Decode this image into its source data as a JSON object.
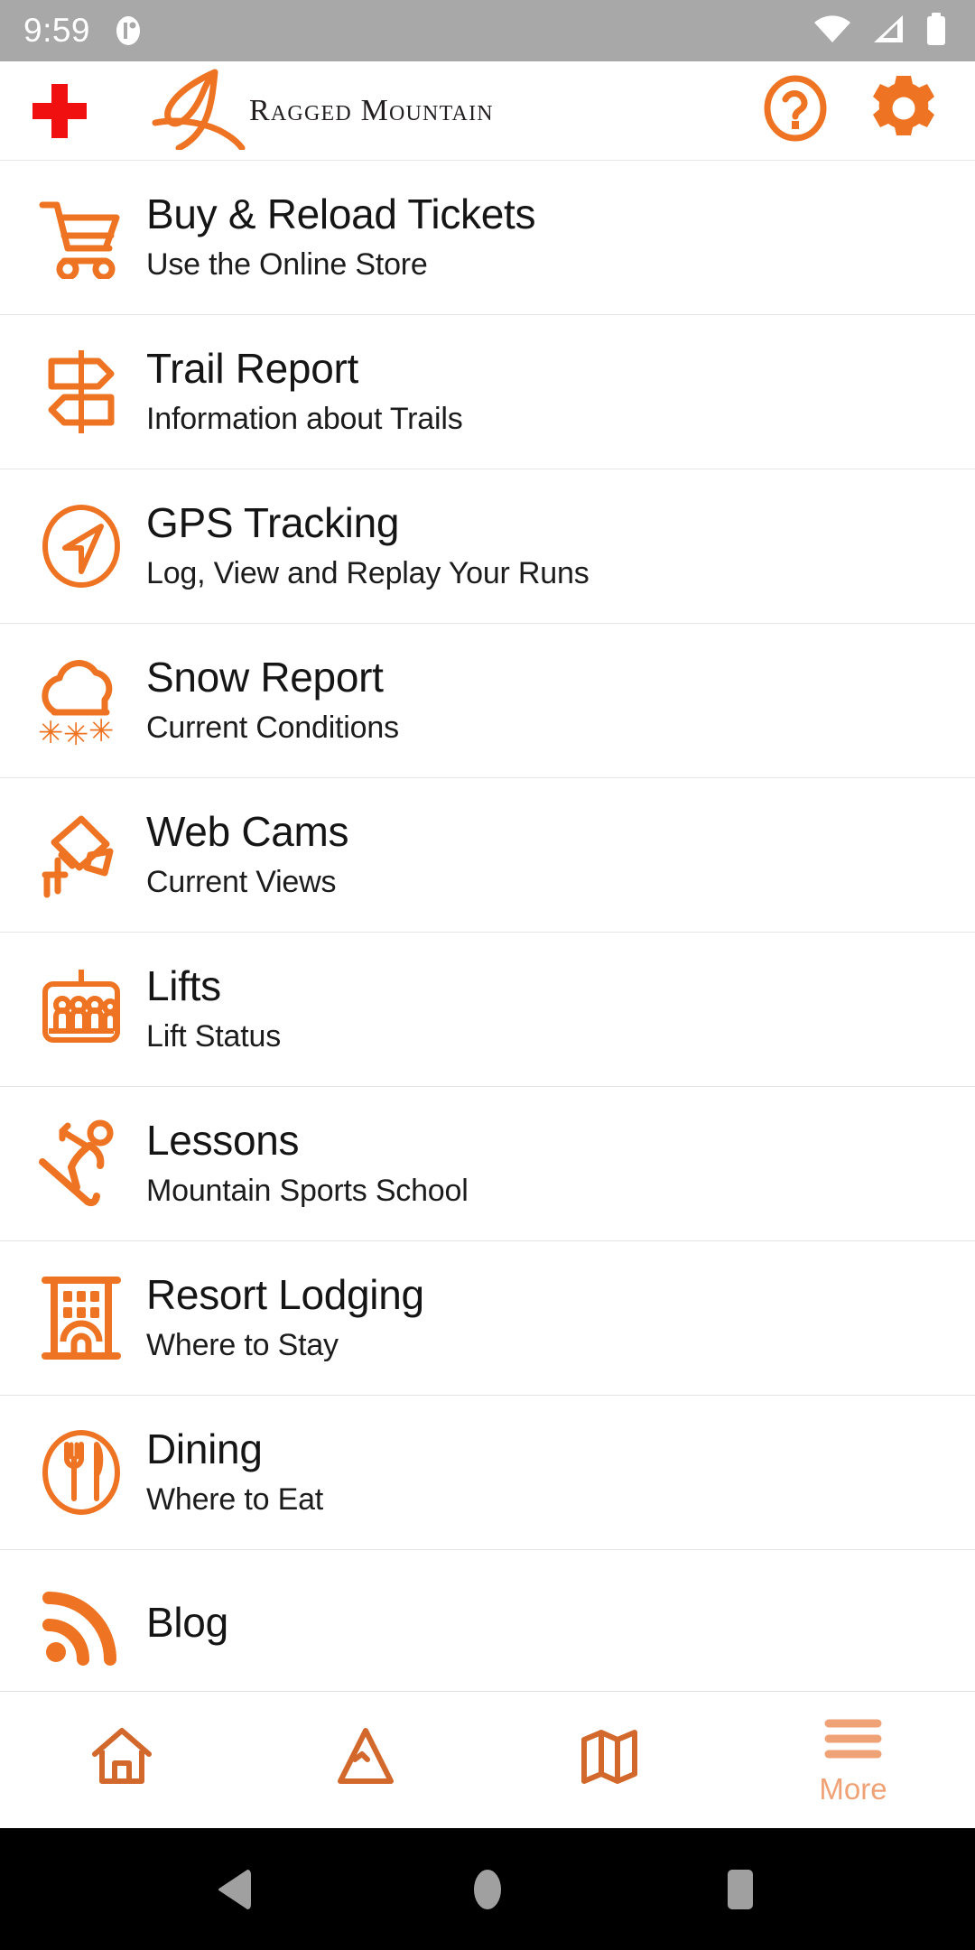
{
  "status_bar": {
    "time": "9:59",
    "icons": [
      "notification-icon",
      "wifi-icon",
      "cellular-signal-icon",
      "battery-icon"
    ]
  },
  "header": {
    "first_aid_icon": "first-aid-cross-icon",
    "logo_text": "Ragged Mountain",
    "help_icon": "help-circle-icon",
    "settings_icon": "gear-icon"
  },
  "colors": {
    "brand_orange": "#ee7423",
    "tab_orange": "#d2682b",
    "tab_active_orange": "#f0a277",
    "first_aid_red": "#f01010",
    "status_bar_gray": "#a8a8a8",
    "title_black": "#151515"
  },
  "menu": {
    "items": [
      {
        "title": "Buy & Reload Tickets",
        "subtitle": "Use the Online Store",
        "icon": "shopping-cart-icon"
      },
      {
        "title": "Trail Report",
        "subtitle": "Information about Trails",
        "icon": "signpost-icon"
      },
      {
        "title": "GPS Tracking",
        "subtitle": "Log, View and Replay Your Runs",
        "icon": "navigation-arrow-icon"
      },
      {
        "title": "Snow Report",
        "subtitle": "Current Conditions",
        "icon": "snow-cloud-icon"
      },
      {
        "title": "Web Cams",
        "subtitle": "Current Views",
        "icon": "video-camera-icon"
      },
      {
        "title": "Lifts",
        "subtitle": "Lift Status",
        "icon": "chairlift-icon"
      },
      {
        "title": "Lessons",
        "subtitle": "Mountain Sports School",
        "icon": "skier-icon"
      },
      {
        "title": "Resort Lodging",
        "subtitle": "Where to Stay",
        "icon": "lodge-building-icon"
      },
      {
        "title": "Dining",
        "subtitle": "Where to Eat",
        "icon": "fork-knife-icon"
      },
      {
        "title": "Blog",
        "subtitle": "",
        "icon": "rss-icon"
      }
    ]
  },
  "tab_bar": {
    "tabs": [
      {
        "label": "",
        "icon": "home-icon",
        "active": false
      },
      {
        "label": "",
        "icon": "mountain-icon",
        "active": false
      },
      {
        "label": "",
        "icon": "map-icon",
        "active": false
      },
      {
        "label": "More",
        "icon": "hamburger-menu-icon",
        "active": true
      }
    ]
  },
  "android_nav": {
    "back": "back-triangle-icon",
    "home": "home-circle-icon",
    "recents": "recents-square-icon"
  }
}
